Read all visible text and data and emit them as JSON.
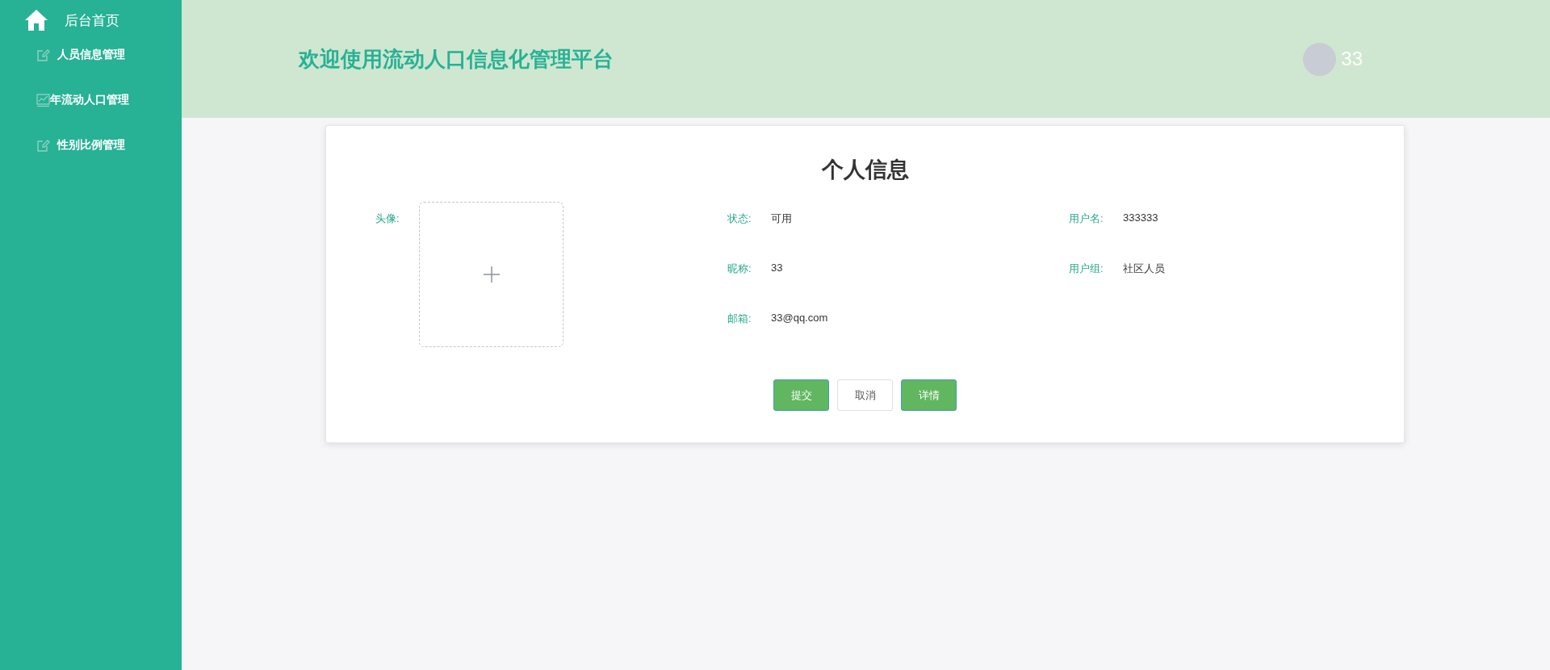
{
  "sidebar": {
    "home": {
      "label": "后台首页"
    },
    "items": [
      {
        "label": "人员信息管理"
      },
      {
        "label": "年流动人口管理"
      },
      {
        "label": "性别比例管理"
      }
    ]
  },
  "header": {
    "title": "欢迎使用流动人口信息化管理平台",
    "user": "33"
  },
  "profile": {
    "title": "个人信息",
    "avatar_label": "头像:",
    "fields": [
      {
        "label": "状态:",
        "value": "可用"
      },
      {
        "label": "用户名:",
        "value": "333333"
      },
      {
        "label": "昵称:",
        "value": "33"
      },
      {
        "label": "用户组:",
        "value": "社区人员"
      },
      {
        "label": "邮箱:",
        "value": "33@qq.com"
      }
    ],
    "buttons": [
      {
        "label": "提交",
        "kind": "primary"
      },
      {
        "label": "取消",
        "kind": "default"
      },
      {
        "label": "详情",
        "kind": "primary"
      }
    ]
  }
}
